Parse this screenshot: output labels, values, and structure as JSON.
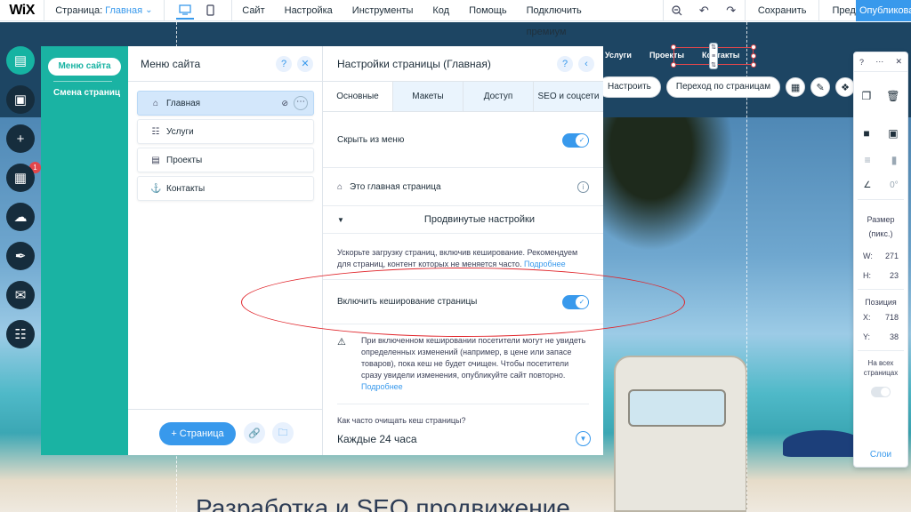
{
  "topbar": {
    "logo": "WiX",
    "page_label": "Страница:",
    "page_value": "Главная",
    "menu": [
      "Сайт",
      "Настройка",
      "Инструменты",
      "Код",
      "Помощь",
      "Подключить премиум"
    ],
    "save": "Сохранить",
    "preview": "Предпросмотр",
    "publish": "Опубликовать"
  },
  "canvas": {
    "nav": [
      "Услуги",
      "Проекты",
      "Контакты"
    ],
    "actions": {
      "settings": "Настроить",
      "goto_pages": "Переход по страницам"
    },
    "bottom_title": "Разработка и SEO продвижение"
  },
  "rail": {
    "badge": "1"
  },
  "site_menu_nav": {
    "active": "Меню сайта",
    "second": "Смена страниц"
  },
  "menu_panel": {
    "title": "Меню сайта",
    "help": "?",
    "pages": [
      "Главная",
      "Услуги",
      "Проекты",
      "Контакты"
    ],
    "add_page": "+ Страница"
  },
  "settings_panel": {
    "title": "Настройки страницы (Главная)",
    "help": "?",
    "tabs": [
      "Основные",
      "Макеты",
      "Доступ",
      "SEO и соцсети"
    ],
    "hide_from_menu": "Скрыть из меню",
    "homepage": "Это главная страница",
    "advanced": "Продвинутые настройки",
    "advanced_desc": "Ускорьте загрузку страниц, включив кеширование. Рекомендуем для страниц, контент которых не меняется часто.",
    "more_link": "Подробнее",
    "enable_cache": "Включить кеширование страницы",
    "warning": "При включенном кешировании посетители могут не увидеть определенных изменений (например, в цене или запасе товаров), пока кеш не будет очищен. Чтобы посетители сразу увидели изменения, опубликуйте сайт повторно.",
    "warning_link": "Подробнее",
    "cache_question": "Как часто очищать кеш страницы?",
    "cache_value": "Каждые 24 часа"
  },
  "inspector": {
    "help": "?",
    "angle": "0°",
    "size_label": "Размер",
    "size_unit": "(пикс.)",
    "w_label": "W:",
    "w_value": "271",
    "h_label": "H:",
    "h_value": "23",
    "pos_label": "Позиция",
    "x_label": "X:",
    "x_value": "718",
    "y_label": "Y:",
    "y_value": "38",
    "all_pages": "На всех страницах",
    "undo": "Слои"
  },
  "colors": {
    "accent": "#3899ec",
    "teal": "#1ab3a3",
    "annotation": "#e0242a"
  }
}
